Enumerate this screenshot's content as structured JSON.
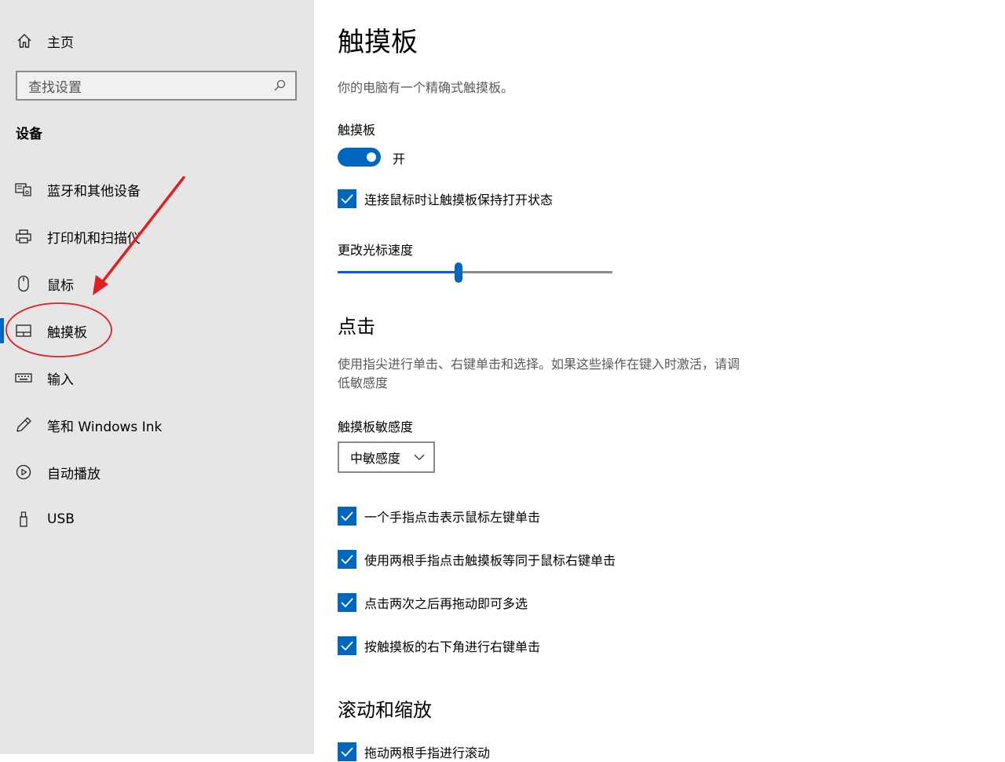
{
  "sidebar": {
    "home_label": "主页",
    "search_placeholder": "查找设置",
    "section_heading": "设备",
    "items": [
      {
        "label": "蓝牙和其他设备",
        "icon": "bluetooth-devices-icon"
      },
      {
        "label": "打印机和扫描仪",
        "icon": "printer-icon"
      },
      {
        "label": "鼠标",
        "icon": "mouse-icon"
      },
      {
        "label": "触摸板",
        "icon": "touchpad-icon",
        "selected": true
      },
      {
        "label": "输入",
        "icon": "keyboard-icon"
      },
      {
        "label": "笔和 Windows Ink",
        "icon": "pen-icon"
      },
      {
        "label": "自动播放",
        "icon": "autoplay-icon"
      },
      {
        "label": "USB",
        "icon": "usb-icon"
      }
    ]
  },
  "main": {
    "title": "触摸板",
    "description": "你的电脑有一个精确式触摸板。",
    "touchpad_toggle": {
      "label": "触摸板",
      "state": "开",
      "on": true
    },
    "keep_on_with_mouse": {
      "label": "连接鼠标时让触摸板保持打开状态",
      "checked": true
    },
    "cursor_speed": {
      "label": "更改光标速度",
      "value": 0.44
    },
    "taps": {
      "title": "点击",
      "description_line1": "使用指尖进行单击、右键单击和选择。如果这些操作在键入时激活，请调",
      "description_line2": "低敏感度",
      "sensitivity_label": "触摸板敏感度",
      "sensitivity_value": "中敏感度",
      "options": [
        {
          "label": "一个手指点击表示鼠标左键单击",
          "checked": true
        },
        {
          "label": "使用两根手指点击触摸板等同于鼠标右键单击",
          "checked": true
        },
        {
          "label": "点击两次之后再拖动即可多选",
          "checked": true
        },
        {
          "label": "按触摸板的右下角进行右键单击",
          "checked": true
        }
      ]
    },
    "scroll_zoom": {
      "title": "滚动和缩放",
      "first_option": {
        "label": "拖动两根手指进行滚动",
        "checked": true
      }
    }
  },
  "colors": {
    "accent": "#0067c0",
    "annotation": "#e02020",
    "sidebar_bg": "#e6e6e6"
  }
}
